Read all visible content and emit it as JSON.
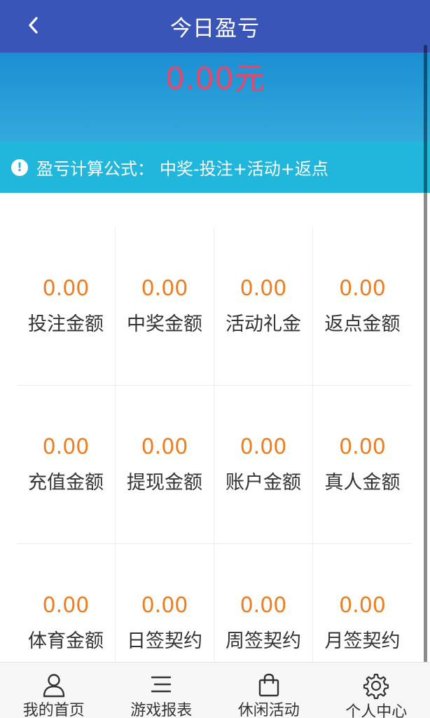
{
  "header": {
    "title": "今日盈亏",
    "back_icon": "back-chevron-icon"
  },
  "summary": {
    "total": "0.00元",
    "color": "#e6476c"
  },
  "formula": {
    "label": "盈亏计算公式：",
    "expression": "中奖-投注+活动+返点",
    "icon": "info-icon"
  },
  "stats": [
    {
      "value": "0.00",
      "label": "投注金额"
    },
    {
      "value": "0.00",
      "label": "中奖金额"
    },
    {
      "value": "0.00",
      "label": "活动礼金"
    },
    {
      "value": "0.00",
      "label": "返点金额"
    },
    {
      "value": "0.00",
      "label": "充值金额"
    },
    {
      "value": "0.00",
      "label": "提现金额"
    },
    {
      "value": "0.00",
      "label": "账户金额"
    },
    {
      "value": "0.00",
      "label": "真人金额"
    },
    {
      "value": "0.00",
      "label": "体育金额"
    },
    {
      "value": "0.00",
      "label": "日签契约"
    },
    {
      "value": "0.00",
      "label": "周签契约"
    },
    {
      "value": "0.00",
      "label": "月签契约"
    }
  ],
  "tabbar": [
    {
      "label": "我的首页",
      "icon": "person-icon"
    },
    {
      "label": "游戏报表",
      "icon": "list-icon"
    },
    {
      "label": "休闲活动",
      "icon": "shopping-bag-icon"
    },
    {
      "label": "个人中心",
      "icon": "gear-icon"
    }
  ],
  "colors": {
    "navbar": "#3a55b8",
    "accent_value": "#ef7d21",
    "formula_bar": "#21b7dc"
  }
}
